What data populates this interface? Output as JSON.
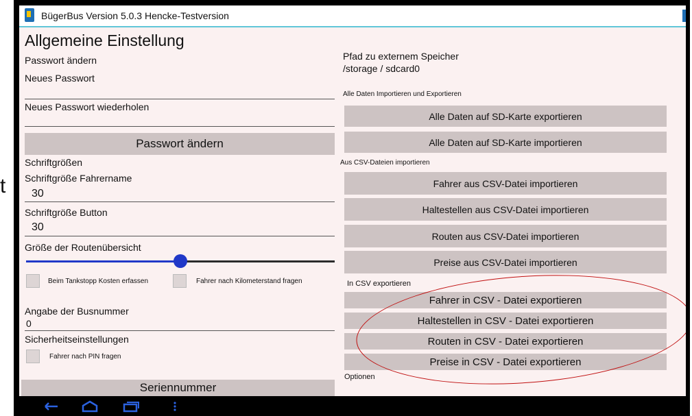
{
  "titlebar": {
    "title": "BügerBus Version 5.0.3 Hencke-Testversion"
  },
  "left": {
    "heading": "Allgemeine Einstellung",
    "password_change_label": "Passwort ändern",
    "new_password_label": "Neues Passwort",
    "repeat_password_label": "Neues Passwort wiederholen",
    "change_password_button": "Passwort ändern",
    "font_sizes_label": "Schriftgrößen",
    "font_size_driver_label": "Schriftgröße Fahrername",
    "font_size_driver_value": "30",
    "font_size_button_label": "Schriftgröße Button",
    "font_size_button_value": "30",
    "route_overview_label": "Größe der Routenübersicht",
    "route_overview_level": 0.5,
    "checkbox_tank": "Beim Tankstopp Kosten erfassen",
    "checkbox_km": "Fahrer nach Kilometerstand fragen",
    "busnumber_label": "Angabe der Busnummer",
    "busnumber_value": "0",
    "security_label": "Sicherheitseinstellungen",
    "checkbox_pin": "Fahrer nach PIN fragen",
    "serial_button": "Seriennummer"
  },
  "right": {
    "storage_path_label": "Pfad zu externem Speicher",
    "storage_path_value": "/storage / sdcard0",
    "import_export_label": "Alle Daten Importieren und Exportieren",
    "export_all": "Alle Daten auf SD-Karte exportieren",
    "import_all": "Alle Daten auf SD-Karte importieren",
    "csv_import_label": "Aus CSV-Dateien importieren",
    "import_drivers": "Fahrer aus CSV-Datei importieren",
    "import_stops": "Haltestellen aus CSV-Datei importieren",
    "import_routes": "Routen aus CSV-Datei importieren",
    "import_prices": "Preise aus CSV-Datei importieren",
    "csv_export_label": "In CSV exportieren",
    "export_drivers": "Fahrer in CSV - Datei exportieren",
    "export_stops": "Haltestellen in CSV - Datei exportieren",
    "export_routes": "Routen in CSV - Datei exportieren",
    "export_prices": "Preise in CSV - Datei exportieren",
    "options_label": "Optionen"
  },
  "stray_text": "t",
  "colors": {
    "accent_blue": "#2038c8",
    "titlebar_line": "#5fc6d8",
    "button_bg": "#cdc3c3",
    "annotation_red": "#c01010",
    "screen_bg": "#fbf1f1"
  },
  "navbar": {
    "icons": [
      "back-icon",
      "home-icon",
      "recent-apps-icon",
      "menu-icon"
    ]
  }
}
